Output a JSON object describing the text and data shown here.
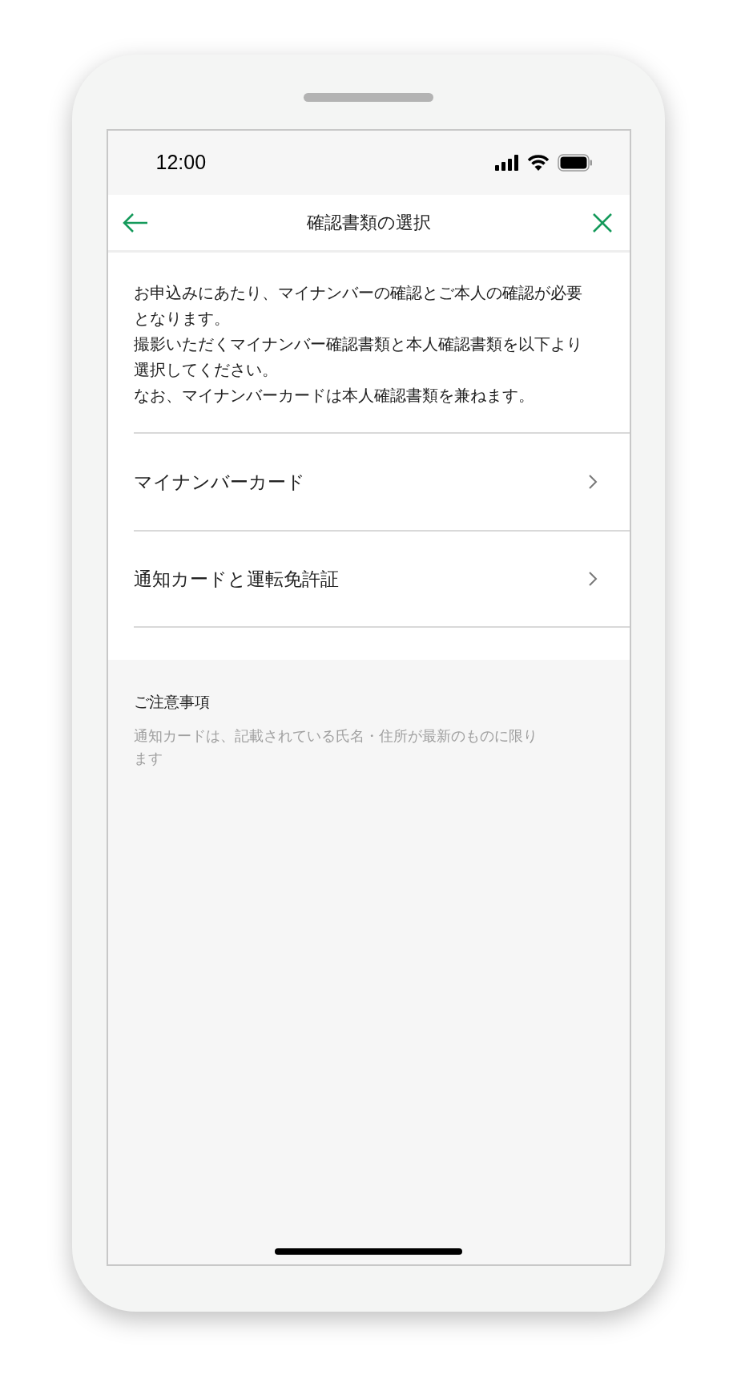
{
  "status_bar": {
    "time": "12:00"
  },
  "header": {
    "title": "確認書類の選択"
  },
  "intro": [
    "お申込みにあたり、マイナンバーの確認とご本人の確認が必要となります。",
    "撮影いただくマイナンバー確認書類と本人確認書類を以下より選択してください。",
    "なお、マイナンバーカードは本人確認書類を兼ねます。"
  ],
  "options": [
    {
      "label": "マイナンバーカード"
    },
    {
      "label": "通知カードと運転免許証"
    }
  ],
  "notes": {
    "title": "ご注意事項",
    "text": "通知カードは、記載されている氏名・住所が最新のものに限ります"
  }
}
